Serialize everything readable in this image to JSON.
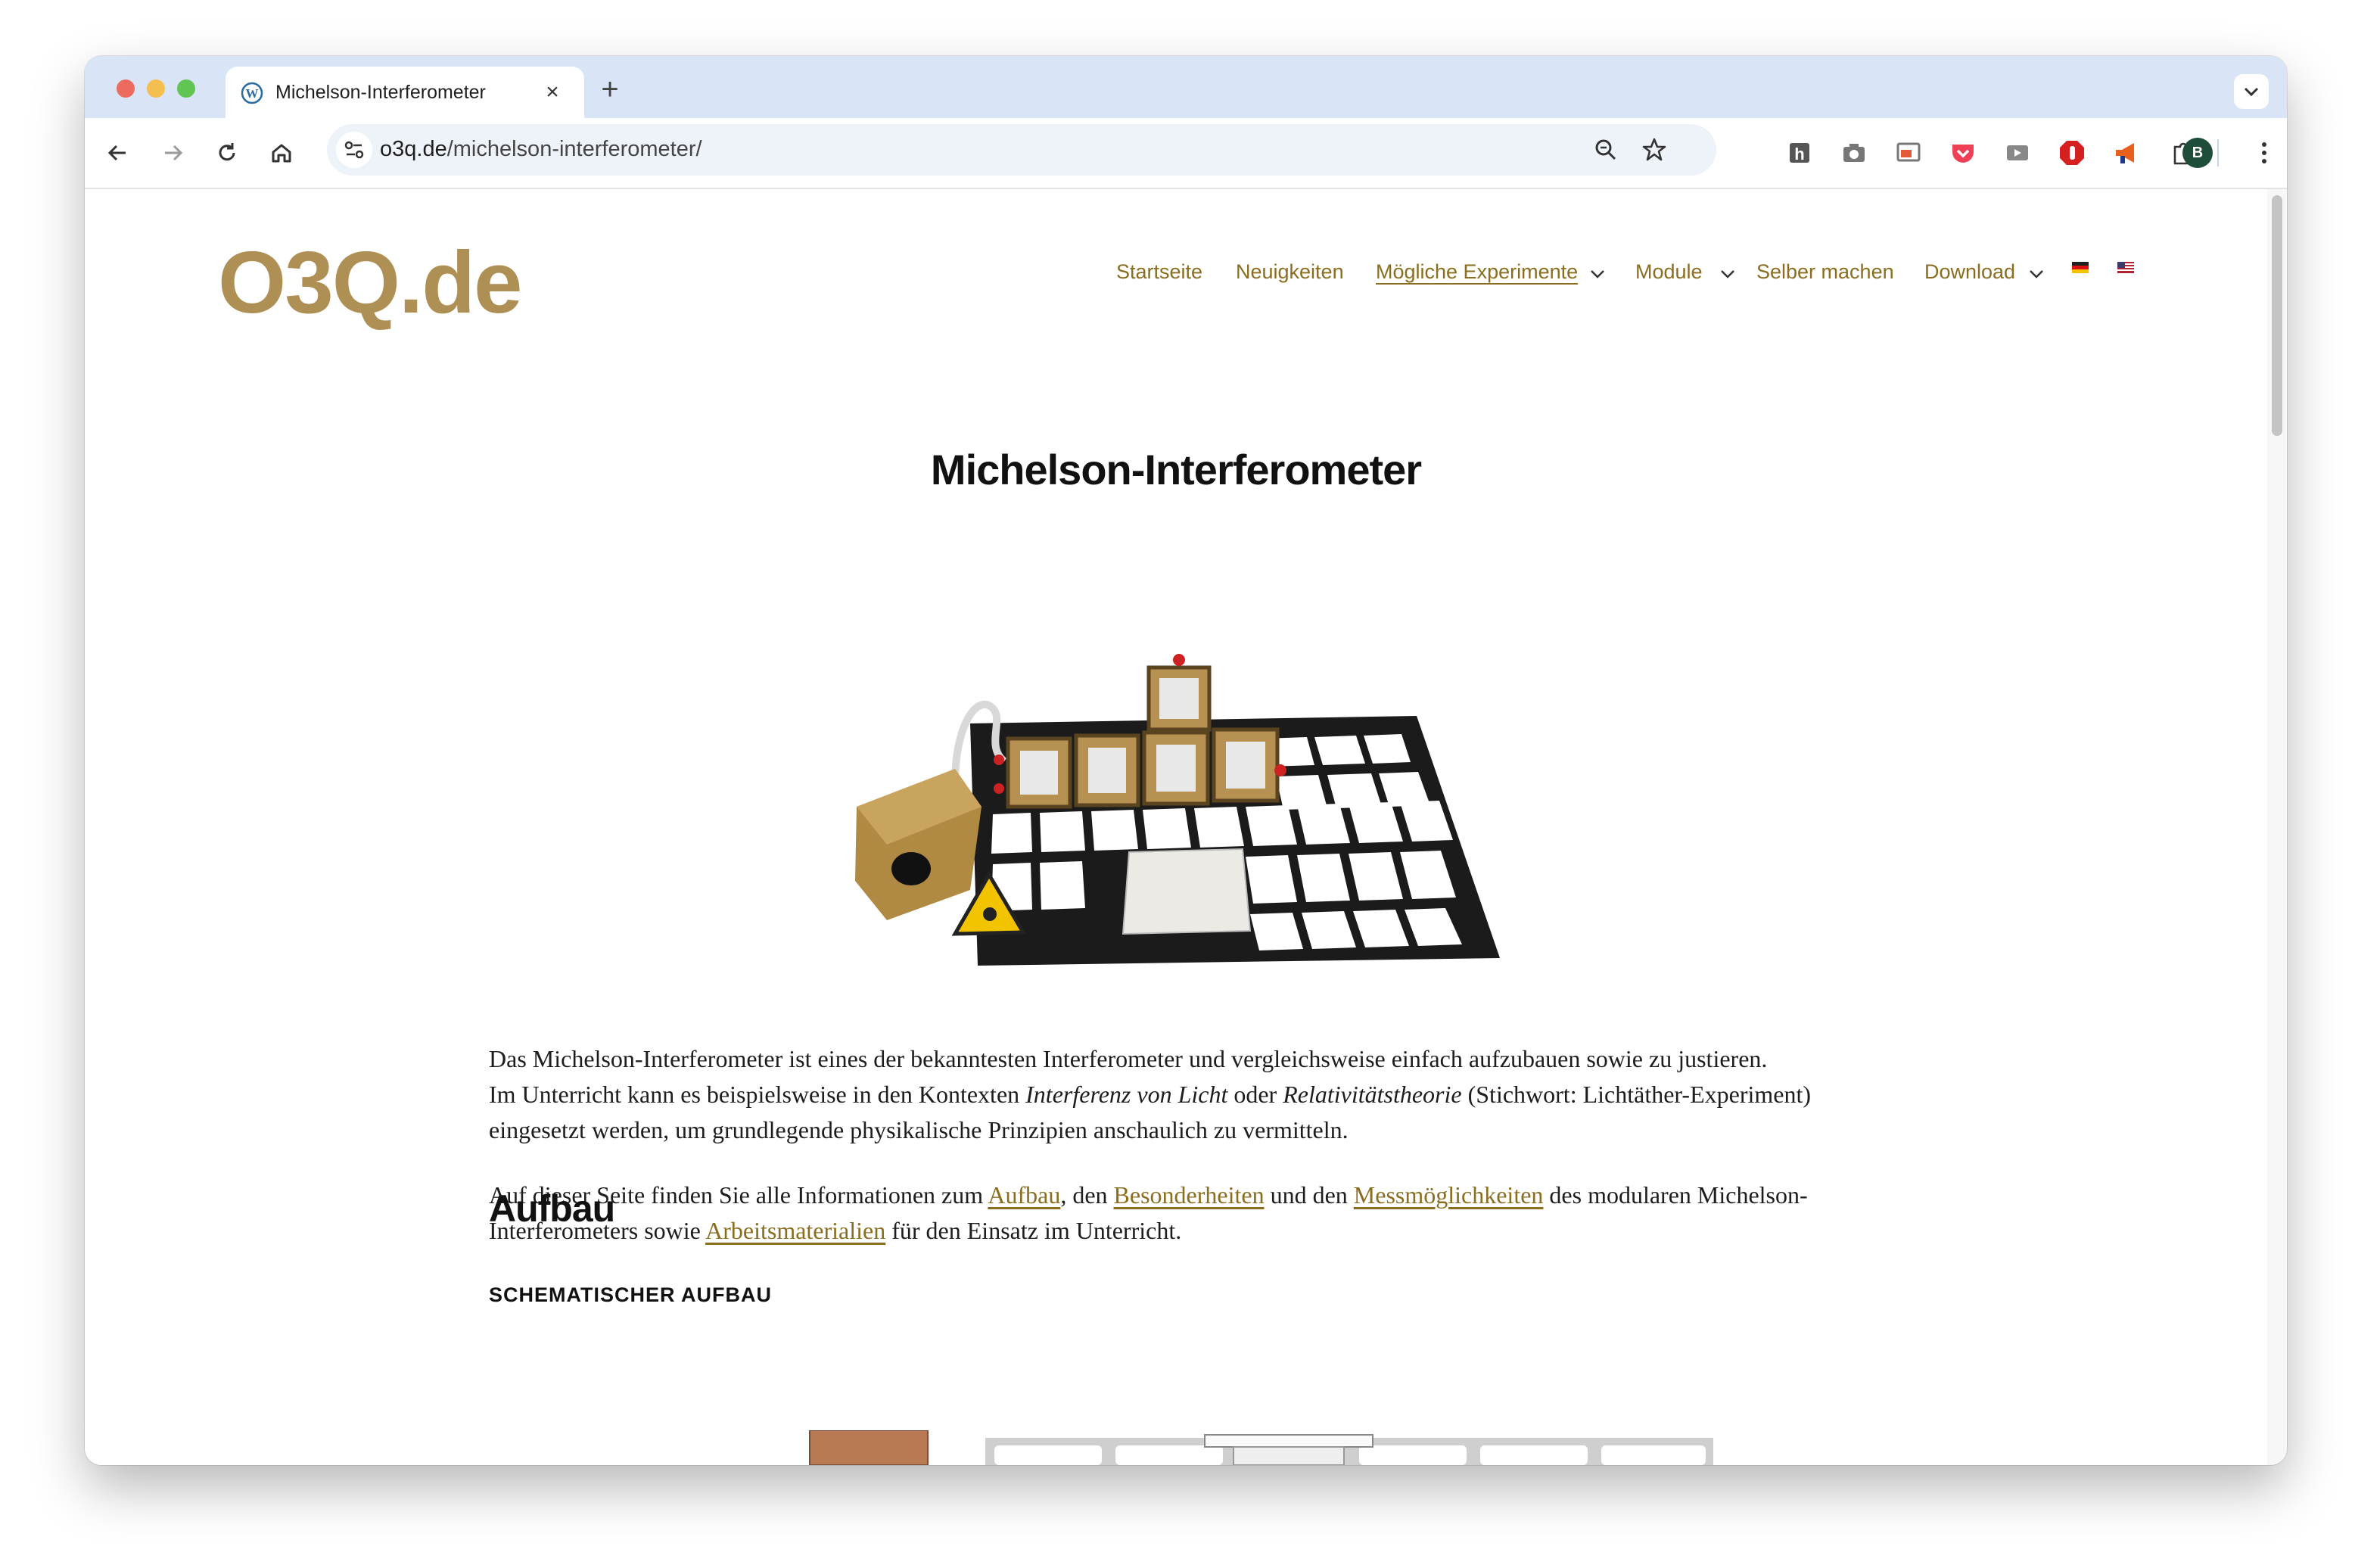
{
  "browser": {
    "tab_title": "Michelson-Interferometer",
    "new_tab_label": "+",
    "close_tab_label": "×",
    "url_domain": "o3q.de",
    "url_path": "/michelson-interferometer/",
    "profile_initial": "B",
    "toolbar_icons": [
      "back-icon",
      "forward-icon",
      "reload-icon",
      "home-icon",
      "zoom-icon",
      "bookmark-star-icon",
      "extensions-puzzle-icon",
      "menu-kebab-icon"
    ],
    "extension_icons": [
      "h-extension-icon",
      "camera-extension-icon",
      "screen-extension-icon",
      "pocket-icon",
      "cast-extension-icon",
      "adblock-icon",
      "megaphone-extension-icon"
    ]
  },
  "site": {
    "logo": "O3Q.de",
    "nav": {
      "startseite": "Startseite",
      "neuigkeiten": "Neuigkeiten",
      "experimente": "Mögliche Experimente",
      "module": "Module",
      "selber": "Selber machen",
      "download": "Download"
    },
    "flags": [
      "de-flag-icon",
      "us-flag-icon"
    ]
  },
  "content": {
    "title": "Michelson-Interferometer",
    "p1": {
      "a": "Das Michelson-Interferometer ist eines der bekanntesten Interferometer und vergleichsweise einfach aufzubauen sowie zu justieren.",
      "b": "Im Unterricht kann es beispielsweise in den Kontexten ",
      "b_em1": "Interferenz von Licht",
      "b_mid": " oder ",
      "b_em2": "Relativitätstheorie",
      "b_end": " (Stichwort: Lichtäther-Experiment)",
      "c": "eingesetzt werden, um grundlegende physikalische Prinzipien anschaulich zu vermitteln."
    },
    "p2": {
      "t1": "Auf dieser Seite finden Sie alle Informationen zum ",
      "l1": "Aufbau",
      "t2": ", den ",
      "l2": "Besonderheiten",
      "t3": " und den ",
      "l3": "Messmöglichkeiten",
      "t4": " des modularen Michelson-",
      "t5": "Interferometers sowie ",
      "l4": "Arbeitsmaterialien",
      "t6": " für den Einsatz im Unterricht."
    },
    "h2": "Aufbau",
    "h4": "SCHEMATISCHER AUFBAU"
  },
  "colors": {
    "accent": "#af9054",
    "link": "#8a6d1e",
    "tabstrip": "#d9e4f7"
  }
}
